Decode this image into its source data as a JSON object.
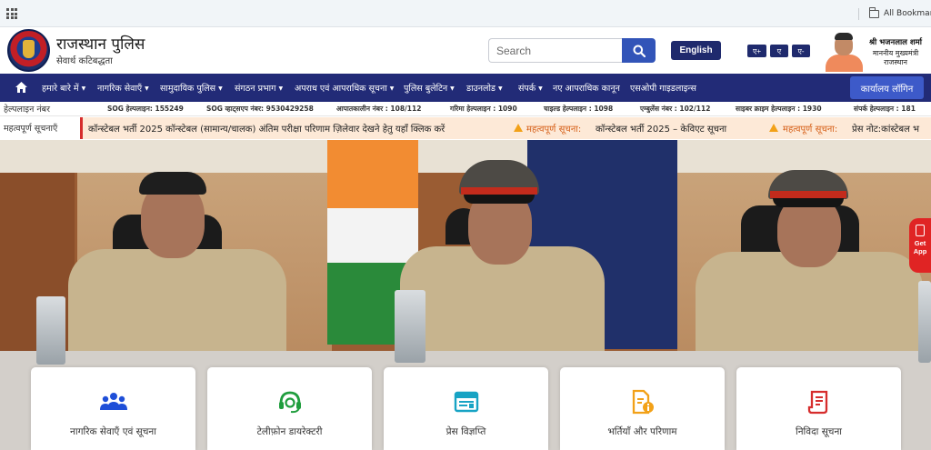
{
  "browser": {
    "all_bookmarks": "All Bookmarks"
  },
  "header": {
    "title": "राजस्थान पुलिस",
    "subtitle": "सेवार्थ कटिबद्धता",
    "search_placeholder": "Search",
    "language_button": "English",
    "font_buttons": [
      "ए+",
      "ए",
      "ए-"
    ],
    "cm_name": "श्री भजनलाल शर्मा",
    "cm_role": "माननीय मुख्यमंत्री",
    "cm_state": "राजस्थान"
  },
  "nav": {
    "items": [
      {
        "label": "हमारे बारे में",
        "dropdown": true
      },
      {
        "label": "नागरिक सेवाएँ",
        "dropdown": true
      },
      {
        "label": "सामुदायिक पुलिस",
        "dropdown": true
      },
      {
        "label": "संगठन प्रभाग",
        "dropdown": true
      },
      {
        "label": "अपराध एवं आपराधिक सूचना",
        "dropdown": true
      },
      {
        "label": "पुलिस बुलेटिन",
        "dropdown": true
      },
      {
        "label": "डाउनलोड",
        "dropdown": true
      },
      {
        "label": "संपर्क",
        "dropdown": true
      },
      {
        "label": "नए आपराधिक कानून",
        "dropdown": false
      },
      {
        "label": "एसओपी गाइडलाइन्स",
        "dropdown": false
      }
    ],
    "login": "कार्यालय लॉगिन"
  },
  "helplines": {
    "label": "हेल्पलाइन नंबर",
    "items": [
      "SOG हेल्पलाइन: 155249",
      "SOG व्हाट्सएप नंबर: 9530429258",
      "आपातकालीन नंबर : 108/112",
      "गरिमा हेल्पलाइन : 1090",
      "चाइल्ड हेल्पलाइन : 1098",
      "एम्बुलेंस नंबर : 102/112",
      "साइबर क्राइम हेल्पलाइन : 1930",
      "संपर्क हेल्पलाइन : 181"
    ]
  },
  "notices": {
    "label": "महत्वपूर्ण सूचनाएँ",
    "tag": "महत्वपूर्ण सूचना:",
    "items": [
      "कॉन्स्टेबल भर्ती 2025 कॉन्स्टेबल (सामान्य/चालक) अंतिम परीक्षा परिणाम ज़िलेवार देखने हेतु यहाँ क्लिक करें",
      "कॉन्स्टेबल भर्ती 2025 – केविएट सूचना",
      "प्रेस नोट:कांस्टेबल भ"
    ]
  },
  "cards": [
    {
      "label": "नागरिक सेवाएँ एवं सूचना",
      "icon": "people-icon",
      "color": "#1e4fd8"
    },
    {
      "label": "टेलीफ़ोन डायरेक्टरी",
      "icon": "headset-icon",
      "color": "#1f9d3d"
    },
    {
      "label": "प्रेस विज्ञप्ति",
      "icon": "newspaper-icon",
      "color": "#17a3c4"
    },
    {
      "label": "भर्तियाँ और परिणाम",
      "icon": "document-info-icon",
      "color": "#f2a118"
    },
    {
      "label": "निविदा सूचना",
      "icon": "tender-scroll-icon",
      "color": "#d62d2d"
    }
  ],
  "app_tab": {
    "line1": "Get",
    "line2": "App"
  },
  "colors": {
    "nav_bg": "#222b77",
    "accent_blue": "#3254b8",
    "ticker_bg": "#fde9d7",
    "ticker_tag": "#d6611a",
    "app_tab": "#e02424"
  }
}
